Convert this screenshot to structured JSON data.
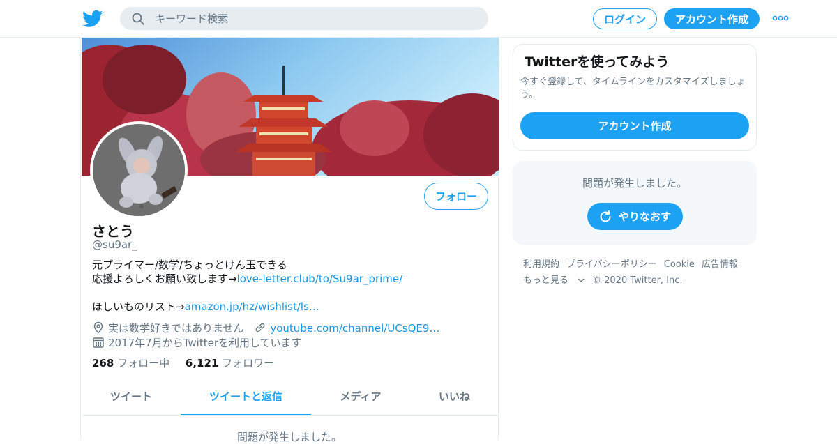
{
  "header": {
    "search_placeholder": "キーワード検索",
    "login_label": "ログイン",
    "signup_label": "アカウント作成"
  },
  "profile": {
    "name": "さとう",
    "handle": "@su9ar_",
    "follow_label": "フォロー",
    "bio": {
      "line1": "元プライマー/数学/ちょっとけん玉できる",
      "line2_text": "応援よろしくお願い致します→",
      "line2_link": "love-letter.club/to/Su9ar_prime/",
      "line4_text": "ほしいものリスト→",
      "line4_link": "amazon.jp/hz/wishlist/ls…"
    },
    "location": "実は数学好きではありません",
    "website": "youtube.com/channel/UCsQE9…",
    "joined": "2017年7月からTwitterを利用しています",
    "following_count": "268",
    "following_label": "フォロー中",
    "followers_count": "6,121",
    "followers_label": "フォロワー"
  },
  "tabs": [
    {
      "label": "ツイート",
      "active": false
    },
    {
      "label": "ツイートと返信",
      "active": true
    },
    {
      "label": "メディア",
      "active": false
    },
    {
      "label": "いいね",
      "active": false
    }
  ],
  "timeline_error": "問題が発生しました。",
  "sidebar": {
    "join_title": "Twitterを使ってみよう",
    "join_desc": "今すぐ登録して、タイムラインをカスタマイズしましょう。",
    "join_button": "アカウント作成",
    "error_msg": "問題が発生しました。",
    "retry_label": "やりなおす"
  },
  "footer": {
    "terms": "利用規約",
    "privacy": "プライバシーポリシー",
    "cookie": "Cookie",
    "ads": "広告情報",
    "more": "もっと見る",
    "copyright": "© 2020 Twitter, Inc."
  },
  "colors": {
    "accent": "#1da1f2",
    "link": "#1b95e0",
    "muted": "#657786",
    "text": "#14171a"
  }
}
